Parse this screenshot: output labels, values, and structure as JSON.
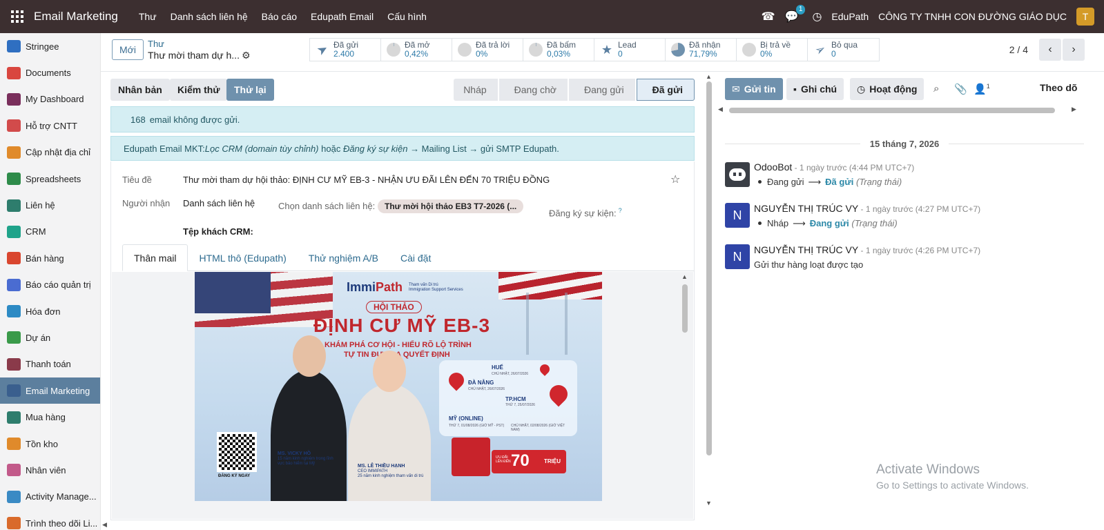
{
  "topbar": {
    "app_name": "Email Marketing",
    "nav": [
      "Thư",
      "Danh sách liên hệ",
      "Báo cáo",
      "Edupath Email",
      "Cấu hình"
    ],
    "chat_badge": "1",
    "user_company": "EduPath",
    "company": "CÔNG TY TNHH CON ĐƯỜNG GIÁO DỤC",
    "avatar_letter": "T"
  },
  "sidebar": {
    "items": [
      {
        "label": "Stringee",
        "color": "#2f6fc1"
      },
      {
        "label": "Documents",
        "color": "#d9463f"
      },
      {
        "label": "My Dashboard",
        "color": "#7a2f5c"
      },
      {
        "label": "Hỗ trợ CNTT",
        "color": "#d24b4b"
      },
      {
        "label": "Cập nhật địa chỉ",
        "color": "#e08a2b"
      },
      {
        "label": "Spreadsheets",
        "color": "#2e8b4a"
      },
      {
        "label": "Liên hệ",
        "color": "#2e7d6d"
      },
      {
        "label": "CRM",
        "color": "#1fa38a"
      },
      {
        "label": "Bán hàng",
        "color": "#d9462f"
      },
      {
        "label": "Báo cáo quản trị",
        "color": "#4a6cd1"
      },
      {
        "label": "Hóa đơn",
        "color": "#2d8ac4"
      },
      {
        "label": "Dự án",
        "color": "#3a9a4a"
      },
      {
        "label": "Thanh toán",
        "color": "#8a3a4a"
      },
      {
        "label": "Email Marketing",
        "color": "#3a5f8e"
      },
      {
        "label": "Mua hàng",
        "color": "#2e7d6d"
      },
      {
        "label": "Tồn kho",
        "color": "#e08a2b"
      },
      {
        "label": "Nhân viên",
        "color": "#c25a8a"
      },
      {
        "label": "Activity Manage...",
        "color": "#3a8ac4"
      },
      {
        "label": "Trình theo dõi Li...",
        "color": "#d96a2b"
      }
    ],
    "active_index": 13
  },
  "control": {
    "new_label": "Mới",
    "breadcrumb_parent": "Thư",
    "breadcrumb_current": "Thư mời tham dự h...",
    "stats": [
      {
        "label": "Đã gửi",
        "value": "2.400",
        "icon": "paper-plane-icon",
        "fill": 1
      },
      {
        "label": "Đã mở",
        "value": "0,42%",
        "icon": "pie-icon",
        "fill": 0.0042
      },
      {
        "label": "Đã trả lời",
        "value": "0%",
        "icon": "pie-icon",
        "fill": 0
      },
      {
        "label": "Đã bấm",
        "value": "0,03%",
        "icon": "pie-icon",
        "fill": 0.0003
      },
      {
        "label": "Lead",
        "value": "0",
        "icon": "star-icon",
        "fill": 0
      },
      {
        "label": "Đã nhận",
        "value": "71,79%",
        "icon": "pie-icon",
        "fill": 0.7179
      },
      {
        "label": "Bị trả về",
        "value": "0%",
        "icon": "pie-icon",
        "fill": 0
      },
      {
        "label": "Bỏ qua",
        "value": "0",
        "icon": "paper-plane-outline-icon",
        "fill": 0
      }
    ],
    "pager": "2 / 4"
  },
  "form": {
    "buttons": [
      "Nhân bản",
      "Kiểm thử",
      "Thử lại"
    ],
    "stages": [
      "Nháp",
      "Đang chờ",
      "Đang gửi",
      "Đã gửi"
    ],
    "alert_count": "168",
    "alert_text": "email không được gửi.",
    "info_prefix": "Edupath Email MKT:",
    "info_crm": "Lọc CRM (domain tùy chỉnh)",
    "info_or": " hoặc ",
    "info_event": "Đăng ký sự kiện",
    "info_rest": " → Mailing List → gửi SMTP Edupath.",
    "subject_label": "Tiêu đề",
    "subject_value": "Thư mời tham dự hội thảo: ĐỊNH CƯ MỸ EB-3 - NHẬN ƯU ĐÃI LÊN ĐẾN 70 TRIỆU ĐỒNG",
    "recipient_label": "Người nhận",
    "recipient_value": "Danh sách liên hệ",
    "list_label": "Chọn danh sách liên hệ:",
    "list_tag": "Thư mời hội thảo EB3 T7-2026 (...",
    "event_label": "Đăng ký sự kiện:",
    "event_help": "?",
    "crm_label": "Tệp khách CRM:",
    "tabs": [
      "Thân mail",
      "HTML thô (Edupath)",
      "Thử nghiệm A/B",
      "Cài đặt"
    ]
  },
  "banner": {
    "logo_a": "Immi",
    "logo_b": "Path",
    "logo_sub1": "Tham vấn Di trú",
    "logo_sub2": "Immigration Support Services",
    "tag": "HỘI THẢO",
    "title": "ĐỊNH CƯ MỸ EB-3",
    "line1": "KHÁM PHÁ CƠ HỘI - HIỂU RÕ LỘ TRÌNH",
    "line2": "TỰ TIN ĐƯA RA QUYẾT ĐỊNH",
    "cities": [
      {
        "name": "HUẾ",
        "date": "CHỦ NHẬT, 26/07/2026"
      },
      {
        "name": "ĐÀ NẴNG",
        "date": "CHỦ NHẬT, 26/07/2026"
      },
      {
        "name": "TP.HCM",
        "date": "THỨ 7, 25/07/2026"
      },
      {
        "name": "MỸ (ONLINE)",
        "date": "THỨ 7, 01/08/2026 (GIỜ MỸ - PST)"
      },
      {
        "name": "",
        "date": "CHỦ NHẬT, 02/08/2026 (GIỜ VIỆT NAM)"
      }
    ],
    "qr_label": "ĐĂNG KÝ NGAY",
    "speaker1_name": "MS. VICKY HỒ",
    "speaker1_desc": "15 năm kinh nghiệm trong lĩnh vực bảo hiểm tại Mỹ",
    "speaker2_name": "MS. LÊ THIỀU HẠNH",
    "speaker2_role": "CEO IMMIPATH",
    "speaker2_desc": "25 năm kinh nghiệm tham vấn di trú",
    "promo_small": "ƯU ĐÃI LÊN ĐẾN",
    "promo_big": "70",
    "promo_unit": "TRIỆU"
  },
  "chatter": {
    "send_label": "Gửi tin",
    "note_label": "Ghi chú",
    "activity_label": "Hoạt động",
    "followers_count": "1",
    "follow_label": "Theo dõ",
    "date": "15 tháng 7, 2026",
    "messages": [
      {
        "author": "OdooBot",
        "date": " - 1 ngày trước (4:44 PM UTC+7)",
        "old": "Đang gửi",
        "new": "Đã gửi",
        "field": "(Trạng thái)"
      },
      {
        "author": "NGUYỄN THỊ TRÚC VY",
        "date": " - 1 ngày trước (4:27 PM UTC+7)",
        "old": "Nháp",
        "new": "Đang gửi",
        "field": "(Trạng thái)",
        "initial": "N"
      },
      {
        "author": "NGUYỄN THỊ TRÚC VY",
        "date": " - 1 ngày trước (4:26 PM UTC+7)",
        "body": "Gửi thư hàng loạt được tạo",
        "initial": "N"
      }
    ]
  },
  "watermark": {
    "line1": "Activate Windows",
    "line2": "Go to Settings to activate Windows."
  }
}
